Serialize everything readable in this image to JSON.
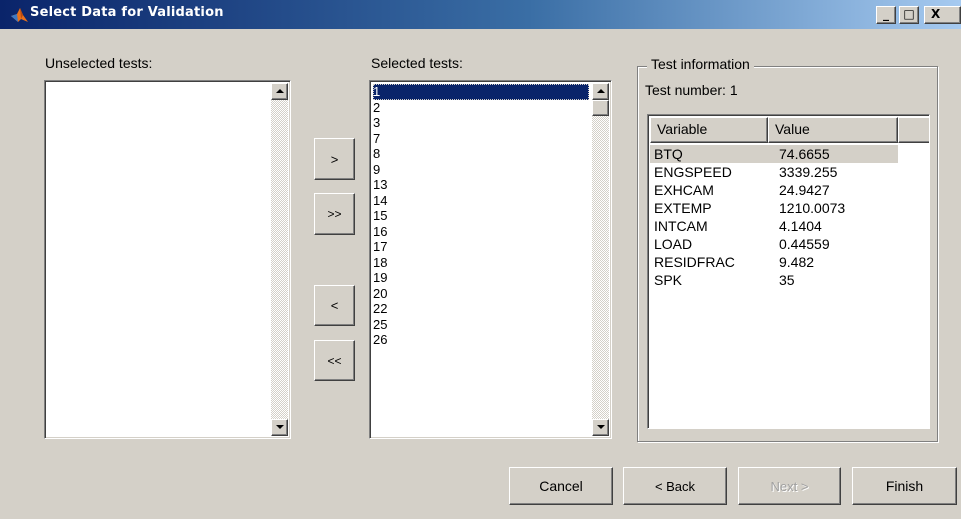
{
  "window": {
    "title": "Select Data for Validation",
    "controls": {
      "minimize": "_",
      "maximize": "□",
      "close": "X"
    }
  },
  "unselected": {
    "label": "Unselected tests:",
    "items": []
  },
  "selected": {
    "label": "Selected tests:",
    "items": [
      "1",
      "2",
      "3",
      "7",
      "8",
      "9",
      "13",
      "14",
      "15",
      "16",
      "17",
      "18",
      "19",
      "20",
      "22",
      "25",
      "26"
    ],
    "selected_index": 0
  },
  "transfer_buttons": {
    "add": ">",
    "add_all": ">>",
    "remove": "<",
    "remove_all": "<<"
  },
  "test_info": {
    "group_title": "Test information",
    "test_number_label": "Test number:",
    "test_number": "1",
    "columns": [
      "Variable",
      "Value",
      ""
    ],
    "rows": [
      {
        "variable": "BTQ",
        "value": "74.6655"
      },
      {
        "variable": "ENGSPEED",
        "value": "3339.255"
      },
      {
        "variable": "EXHCAM",
        "value": "24.9427"
      },
      {
        "variable": "EXTEMP",
        "value": "1210.0073"
      },
      {
        "variable": "INTCAM",
        "value": "4.1404"
      },
      {
        "variable": "LOAD",
        "value": "0.44559"
      },
      {
        "variable": "RESIDFRAC",
        "value": "9.482"
      },
      {
        "variable": "SPK",
        "value": "35"
      }
    ]
  },
  "footer": {
    "cancel": "Cancel",
    "back": "< Back",
    "next": "Next >",
    "finish": "Finish"
  },
  "colors": {
    "selection": "#0a246a",
    "face": "#d4d0c8",
    "disabled_text": "#a0a0a0"
  },
  "icons": {
    "app": "matlab-logo-icon",
    "scroll_up": "arrow-up-icon",
    "scroll_down": "arrow-down-icon"
  }
}
